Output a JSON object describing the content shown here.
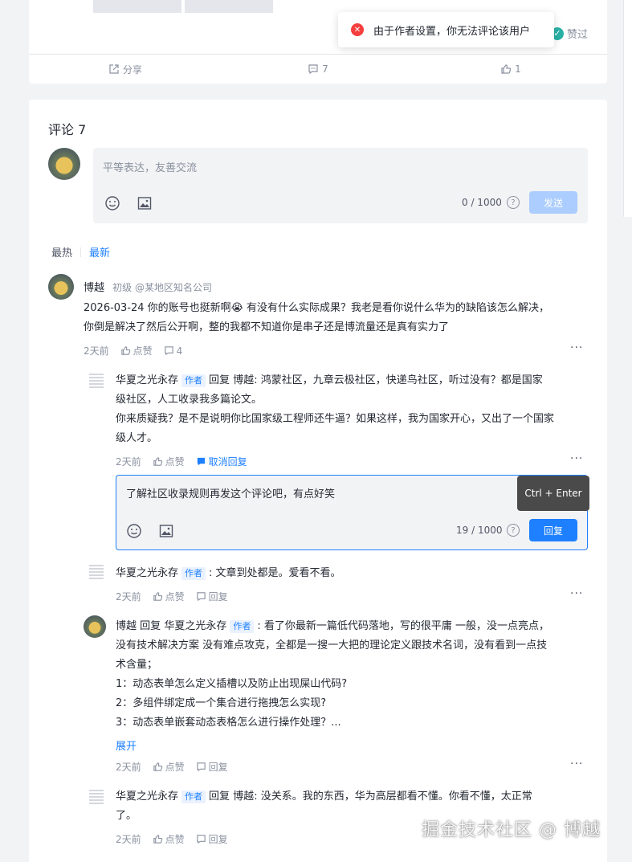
{
  "toast": {
    "message": "由于作者设置，你无法评论该用户"
  },
  "article_actions": {
    "share": "分享",
    "comment_count": "7",
    "like_count": "1",
    "zan": "赞过"
  },
  "comments_section": {
    "title": "评论 7",
    "input_placeholder": "平等表达，友善交流",
    "counter": "0 / 1000",
    "send": "发送",
    "tabs": [
      "最热",
      "最新"
    ]
  },
  "comments": [
    {
      "user": "博越",
      "level": "初级 @某地区知名公司",
      "text_lines": [
        "2026-03-24 你的账号也挺新啊😭 有没有什么实际成果？我老是看你说什么华为的缺陷该怎么解决，",
        "你倒是解决了然后公开啊，整的我都不知道你是串子还是博流量还是真有实力了"
      ],
      "time": "2天前",
      "like": "点赞",
      "reply_count": "4"
    }
  ],
  "replies": [
    {
      "user": "华夏之光永存",
      "badge": "作者",
      "reply_word": "回复",
      "reply_to": "博越",
      "text_lines": [
        ": 鸿蒙社区，九章云极社区，快递鸟社区，听过没有？都是国家",
        "级社区，人工收录我多篇论文。",
        "你来质疑我？是不是说明你比国家级工程师还牛逼？如果这样，我为国家开心，又出了一个国家",
        "级人才。"
      ],
      "time": "2天前",
      "like": "点赞",
      "cancel_reply": "取消回复"
    },
    {
      "user": "华夏之光永存",
      "badge": "作者",
      "text_lines": [
        ": 文章到处都是。爱看不看。"
      ],
      "time": "2天前",
      "like": "点赞",
      "reply": "回复"
    },
    {
      "user": "博越",
      "reply_word": "回复",
      "reply_to": "华夏之光永存",
      "badge": "作者",
      "text_lines": [
        ": 看了你最新一篇低代码落地，写的很平庸 一般，没一点亮点，",
        "没有技术解决方案 没有难点攻克，全都是一搜一大把的理论定义跟技术名词，没有看到一点技",
        "术含量；",
        "1：动态表单怎么定义插槽以及防止出现屎山代码?",
        "2：多组件绑定成一个集合进行拖拽怎么实现?",
        "3：动态表单嵌套动态表格怎么进行操作处理？..."
      ],
      "expand": "展开",
      "time": "2天前",
      "like": "点赞",
      "reply": "回复"
    },
    {
      "user": "华夏之光永存",
      "badge": "作者",
      "reply_word": "回复",
      "reply_to": "博越",
      "text_lines": [
        ": 没关系。我的东西，华为高层都看不懂。你看不懂，太正常",
        "了。"
      ],
      "time": "2天前",
      "like": "点赞",
      "reply": "回复"
    }
  ],
  "reply_box": {
    "text": "了解社区收录规则再发这个评论吧，有点好笑",
    "counter": "19 / 1000",
    "send": "回复",
    "tooltip": "Ctrl + Enter"
  },
  "watermark": "掘金技术社区 @ 博越",
  "colors": {
    "accent": "#1e80ff",
    "send_disabled": "#abcdff",
    "error": "#f53f3f"
  }
}
